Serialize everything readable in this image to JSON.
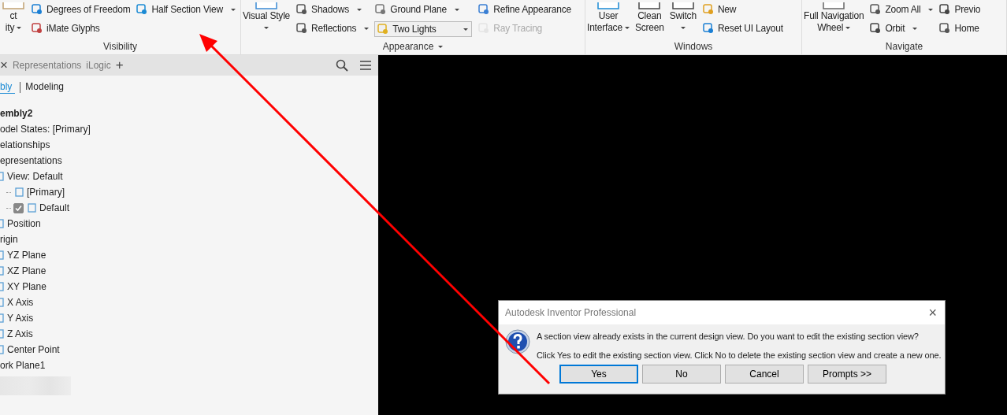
{
  "ribbon": {
    "groups": [
      {
        "label": "Visibility",
        "label_dropdown": false,
        "columns": [
          [
            {
              "kind": "large-split",
              "lines": [
                "ct",
                "ity"
              ],
              "dropdown": true
            }
          ],
          [
            {
              "kind": "small",
              "label": "Degrees of Freedom",
              "dropdown": false,
              "disabled": false
            },
            {
              "kind": "small",
              "label": "iMate Glyphs",
              "dropdown": false,
              "disabled": false
            }
          ],
          [
            {
              "kind": "small",
              "label": "Half Section View",
              "dropdown": true,
              "disabled": false
            }
          ]
        ]
      },
      {
        "label": "Appearance",
        "label_dropdown": true,
        "columns": [
          [
            {
              "kind": "large-menu",
              "lines": [
                "Visual Style"
              ],
              "dropdown": true
            }
          ],
          [
            {
              "kind": "small",
              "label": "Shadows",
              "dropdown": true,
              "disabled": false
            },
            {
              "kind": "small",
              "label": "Reflections",
              "dropdown": true,
              "disabled": false
            }
          ],
          [
            {
              "kind": "small",
              "label": "Ground Plane",
              "dropdown": true,
              "disabled": false
            },
            {
              "kind": "combo",
              "label": "Two Lights",
              "dropdown": true
            }
          ],
          [
            {
              "kind": "small",
              "label": "Refine Appearance",
              "dropdown": false,
              "disabled": false
            },
            {
              "kind": "small",
              "label": "Ray Tracing",
              "dropdown": false,
              "disabled": true
            }
          ]
        ]
      },
      {
        "label": "Windows",
        "label_dropdown": false,
        "columns": [
          [
            {
              "kind": "large-split",
              "lines": [
                "User",
                "Interface"
              ],
              "dropdown": true
            }
          ],
          [
            {
              "kind": "large-split",
              "lines": [
                "Clean",
                "Screen"
              ],
              "dropdown": false
            }
          ],
          [
            {
              "kind": "large-menu",
              "lines": [
                "Switch"
              ],
              "dropdown": true
            }
          ],
          [
            {
              "kind": "small",
              "label": "New",
              "dropdown": false,
              "disabled": false
            },
            {
              "kind": "small",
              "label": "Reset UI Layout",
              "dropdown": false,
              "disabled": false
            }
          ]
        ]
      },
      {
        "label": "Navigate",
        "label_dropdown": false,
        "columns": [
          [
            {
              "kind": "large-split",
              "lines": [
                "Full Navigation",
                "Wheel"
              ],
              "dropdown": true
            }
          ],
          [
            {
              "kind": "small",
              "label": "Zoom All",
              "dropdown": true,
              "disabled": false
            },
            {
              "kind": "small",
              "label": "Orbit",
              "dropdown": true,
              "disabled": false
            }
          ],
          [
            {
              "kind": "small",
              "label": "Previo",
              "dropdown": false,
              "disabled": false
            },
            {
              "kind": "small",
              "label": "Home",
              "dropdown": false,
              "disabled": false
            }
          ]
        ]
      }
    ]
  },
  "browser": {
    "close": "×",
    "tabs": [
      {
        "label": "Representations",
        "selected": false
      },
      {
        "label": "iLogic",
        "selected": false
      }
    ],
    "add": "+",
    "subtabs": [
      {
        "label": "bly",
        "selected": true
      },
      {
        "label": "Modeling",
        "selected": false
      }
    ],
    "tree": [
      {
        "label": "embly2",
        "children": [
          {
            "label": "odel States: [Primary]"
          },
          {
            "label": "elationships"
          },
          {
            "label": "epresentations",
            "children": [
              {
                "label": "View: Default",
                "children": [
                  {
                    "label": "[Primary]"
                  },
                  {
                    "label": "Default",
                    "checked": true
                  }
                ]
              },
              {
                "label": "Position"
              }
            ]
          },
          {
            "label": "rigin",
            "children": [
              {
                "label": "YZ Plane"
              },
              {
                "label": "XZ Plane"
              },
              {
                "label": "XY Plane"
              },
              {
                "label": "X Axis"
              },
              {
                "label": "Y Axis"
              },
              {
                "label": "Z Axis"
              },
              {
                "label": "Center Point"
              }
            ]
          },
          {
            "label": "ork Plane1"
          }
        ]
      }
    ]
  },
  "dialog": {
    "title": "Autodesk Inventor Professional",
    "close": "×",
    "message": "A section view already exists in the current design view. Do you want to edit the existing section view?",
    "detail": "Click Yes to edit the existing section view. Click No to delete the existing section view and create a new one.",
    "buttons": [
      {
        "label": "Yes",
        "selected": true
      },
      {
        "label": "No",
        "selected": false
      },
      {
        "label": "Cancel",
        "selected": false
      },
      {
        "label": "Prompts >>",
        "selected": false
      }
    ]
  }
}
